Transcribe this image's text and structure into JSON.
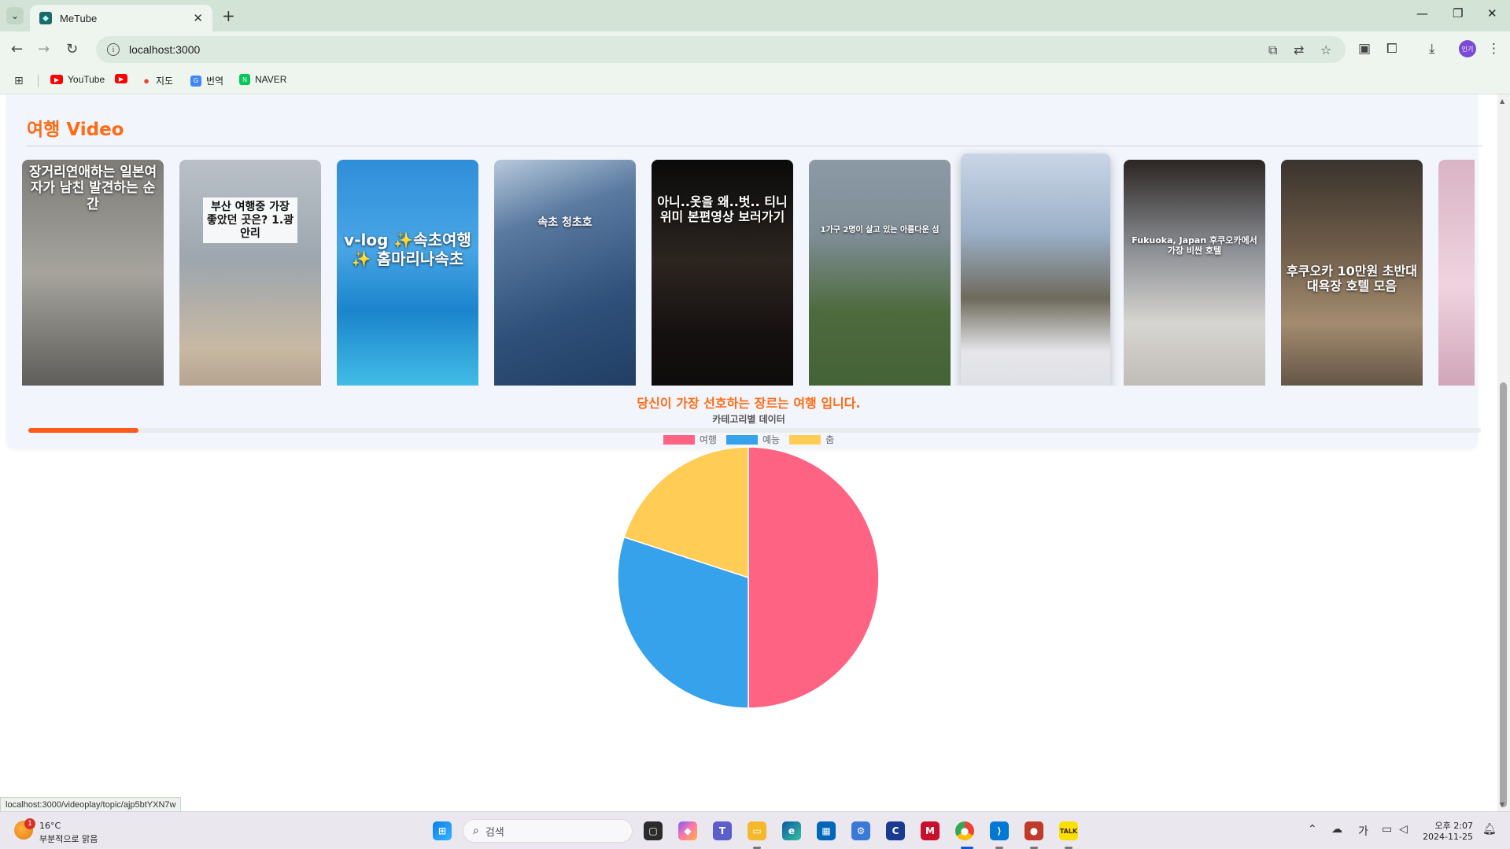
{
  "browser": {
    "tab_title": "MeTube",
    "url": "localhost:3000",
    "profile_initials": "인기",
    "bookmarks": [
      {
        "label": "YouTube",
        "icon": "youtube-icon"
      },
      {
        "label": "",
        "icon": "youtube-icon"
      },
      {
        "label": "지도",
        "icon": "maps-pin-icon"
      },
      {
        "label": "번역",
        "icon": "translate-icon"
      },
      {
        "label": "NAVER",
        "icon": "naver-icon"
      }
    ]
  },
  "section": {
    "category": "여행",
    "suffix": "Video"
  },
  "videos": [
    {
      "caption": "장거리연애하는 일본여자가 남친 발견하는 순간",
      "bg": "linear-gradient(180deg,#7d7c78 0%,#a6a49d 45%,#4e4d4a 100%)"
    },
    {
      "caption": "부산 여행중 가장 좋았던 곳은? 1.광안리",
      "bg": "linear-gradient(180deg,#b9c0c8 0%,#9da6ae 40%,#c8b9a3 75%,#a79683 100%)"
    },
    {
      "caption": "v-log ✨속초여행✨ 홈마리나속초",
      "bg": "linear-gradient(180deg,#2f8ed8 0%,#48a6e6 35%,#1b84cc 60%,#4fd0ee 100%)"
    },
    {
      "caption": "속초 청초호",
      "bg": "linear-gradient(160deg,#b7c9dc 0%,#5a7aa0 25%,#2f507a 60%,#1d3a5e 100%)"
    },
    {
      "caption": "아니..옷을 왜..벗.. 티니위미 본편영상 보러가기",
      "bg": "linear-gradient(180deg,#0a0a0a 0%,#2c2520 40%,#151010 70%,#0a0a0a 100%)"
    },
    {
      "caption": "1가구 2명이 살고 있는 아름다운 섬",
      "bg": "linear-gradient(180deg,#8c9aa6 0%,#7f8d96 30%,#4e6b3e 60%,#3f5f33 100%)"
    },
    {
      "caption": "",
      "bg": "linear-gradient(180deg,#c9d6e6 0%,#9bb0c8 30%,#6e6a5c 55%,#e6e6ea 75%,#d8dbe3 100%)"
    },
    {
      "caption": "Fukuoka, Japan 후쿠오카에서 가장 비싼 호텔",
      "bg": "linear-gradient(180deg,#2b2522 0%,#8a8d93 35%,#d7d5d1 65%,#b7b3ad 100%)"
    },
    {
      "caption": "후쿠오카 10만원 초반대 대욕장 호텔 모음",
      "bg": "linear-gradient(180deg,#3a332d 0%,#6e5c49 35%,#a38c6f 65%,#4a3f35 100%)"
    },
    {
      "caption": "",
      "bg": "linear-gradient(180deg,#d9b4c4 0%,#f0d3df 50%,#c89aae 100%)"
    }
  ],
  "carousel_progress": 0.076,
  "chart_section": {
    "heading": "당신이 가장 선호하는 장르는 여행 입니다.",
    "title": "카테고리별 데이터"
  },
  "chart_data": {
    "type": "pie",
    "title": "카테고리별 데이터",
    "categories": [
      "여행",
      "예능",
      "춤"
    ],
    "values": [
      50,
      30,
      20
    ],
    "colors": [
      "#ff6384",
      "#36a2eb",
      "#ffcd56"
    ],
    "legend_position": "top"
  },
  "status_bar_url": "localhost:3000/videoplay/topic/ajp5btYXN7w",
  "taskbar": {
    "temperature": "16°C",
    "weather": "부분적으로 맑음",
    "weather_badge": "1",
    "search_placeholder": "검색",
    "time": "오후 2:07",
    "date": "2024-11-25",
    "ime": "가"
  }
}
